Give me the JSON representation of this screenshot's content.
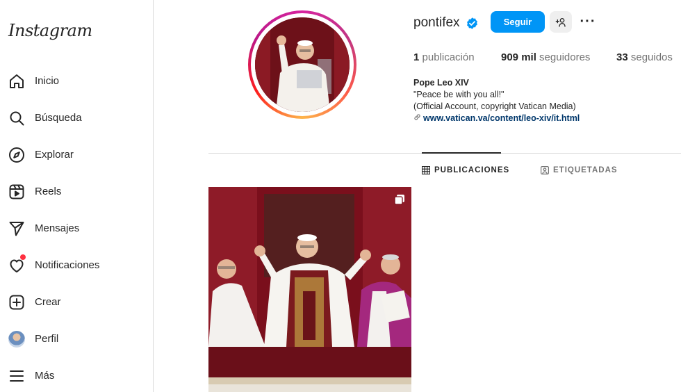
{
  "sidebar": {
    "logo": "Instagram",
    "items": [
      {
        "label": "Inicio",
        "icon": "home-icon"
      },
      {
        "label": "Búsqueda",
        "icon": "search-icon"
      },
      {
        "label": "Explorar",
        "icon": "compass-icon"
      },
      {
        "label": "Reels",
        "icon": "reels-icon"
      },
      {
        "label": "Mensajes",
        "icon": "send-icon"
      },
      {
        "label": "Notificaciones",
        "icon": "heart-icon"
      },
      {
        "label": "Crear",
        "icon": "plus-square-icon"
      },
      {
        "label": "Perfil",
        "icon": "avatar"
      },
      {
        "label": "Más",
        "icon": "menu-icon"
      }
    ]
  },
  "profile": {
    "username": "pontifex",
    "follow_label": "Seguir",
    "suggest_label": "+ዶ",
    "more_label": "···",
    "stats": {
      "posts_count": "1",
      "posts_label": "publicación",
      "followers_count": "909 mil",
      "followers_label": "seguidores",
      "following_count": "33",
      "following_label": "seguidos"
    },
    "bio": {
      "name": "Pope Leo XIV",
      "line1": "\"Peace be with you all!\"",
      "line2": "(Official Account, copyright Vatican Media)",
      "link": "www.vatican.va/content/leo-xiv/it.html"
    }
  },
  "tabs": [
    {
      "label": "PUBLICACIONES",
      "active": true
    },
    {
      "label": "ETIQUETADAS",
      "active": false
    }
  ],
  "colors": {
    "accent": "#0095f6",
    "notification_dot": "#ff3040",
    "link": "#00376b",
    "verified": "#0095f6"
  }
}
